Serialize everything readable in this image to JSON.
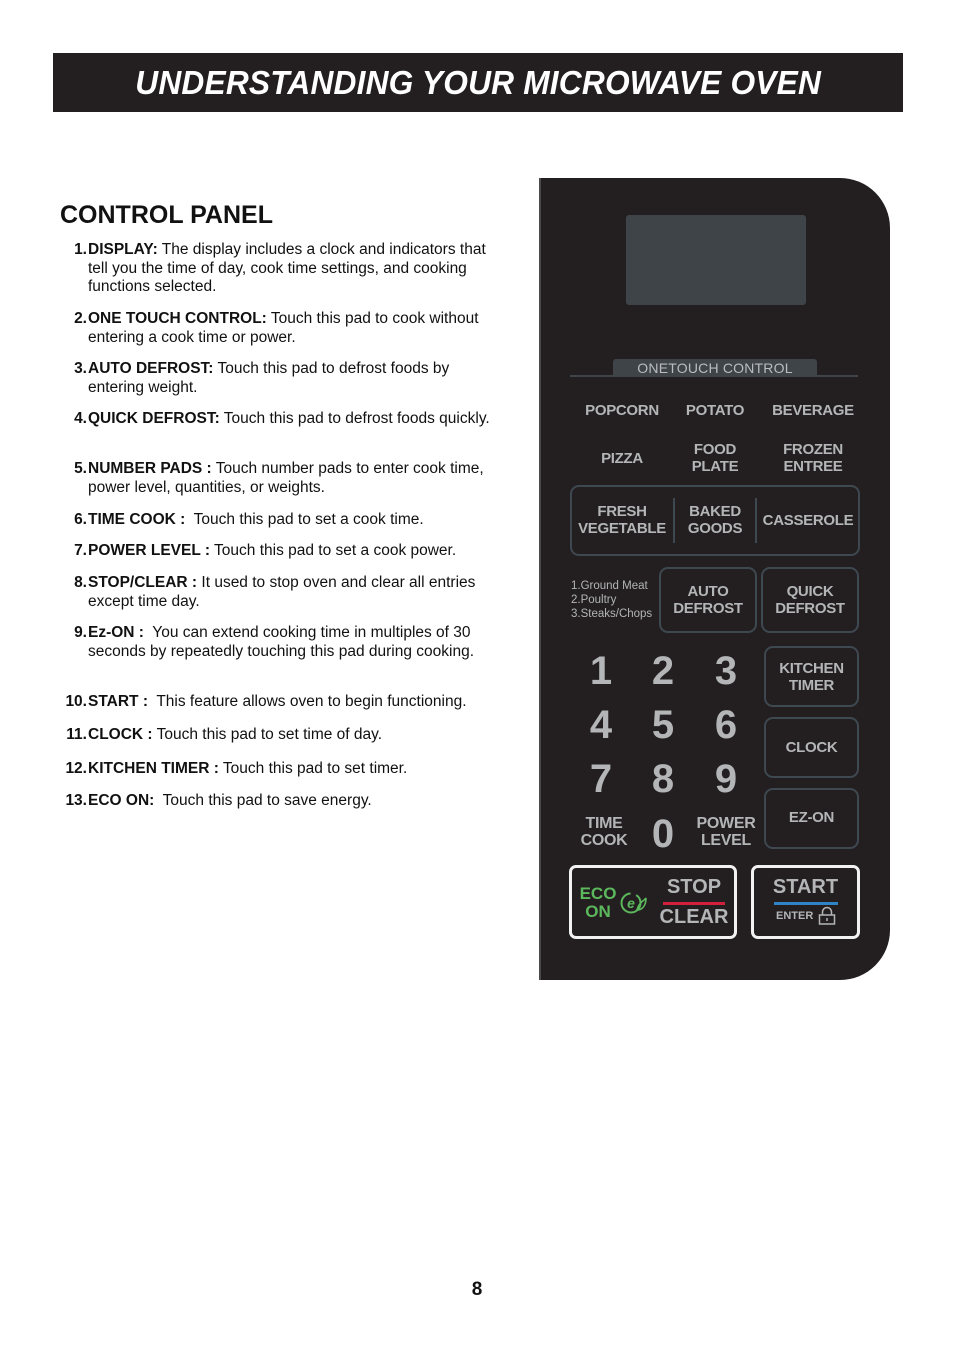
{
  "header": {
    "title": "UNDERSTANDING YOUR MICROWAVE OVEN"
  },
  "section": {
    "title": "CONTROL PANEL"
  },
  "items": [
    {
      "num": "1.",
      "label": "DISPLAY:",
      "text": " The display includes a clock and indicators that tell you the time of day, cook time settings, and cooking functions selected."
    },
    {
      "num": "2.",
      "label": "ONE TOUCH CONTROL:",
      "text": " Touch this pad to cook without entering a cook time or power."
    },
    {
      "num": "3.",
      "label": "AUTO DEFROST:",
      "text": " Touch this pad to defrost foods by entering weight."
    },
    {
      "num": "4.",
      "label": "QUICK DEFROST:",
      "text": " Touch this pad to defrost foods quickly."
    },
    {
      "num": "5.",
      "label": "NUMBER PADS :",
      "text": " Touch number pads to enter cook time, power level, quantities, or weights."
    },
    {
      "num": "6.",
      "label": "TIME COOK :",
      "text": "  Touch this pad to set a cook time."
    },
    {
      "num": "7.",
      "label": "POWER LEVEL :",
      "text": " Touch this pad to set a cook power."
    },
    {
      "num": "8.",
      "label": "STOP/CLEAR :",
      "text": " It used to stop oven and clear all entries except time day."
    },
    {
      "num": "9.",
      "label": "Ez-ON :",
      "text": "  You can extend cooking time in multiples of 30 seconds by repeatedly touching this pad during cooking."
    },
    {
      "num": "10.",
      "label": "START :",
      "text": "  This feature allows oven to begin functioning."
    },
    {
      "num": "11.",
      "label": "CLOCK :",
      "text": " Touch this pad to set time of day."
    },
    {
      "num": "12.",
      "label": "KITCHEN TIMER :",
      "text": " Touch this pad to set timer."
    },
    {
      "num": "13.",
      "label": "ECO ON:",
      "text": "  Touch this pad to save energy."
    }
  ],
  "panel": {
    "one_touch_label": "ONETOUCH CONTROL",
    "one_touch": {
      "popcorn": "POPCORN",
      "potato": "POTATO",
      "beverage": "BEVERAGE",
      "pizza": "PIZZA",
      "food_plate": "FOOD\nPLATE",
      "frozen_entree": "FROZEN\nENTREE",
      "fresh_vegetable": "FRESH\nVEGETABLE",
      "baked_goods": "BAKED\nGOODS",
      "casserole": "CASSEROLE"
    },
    "defrost_options": [
      "1.Ground Meat",
      "2.Poultry",
      "3.Steaks/Chops"
    ],
    "auto_defrost": "AUTO\nDEFROST",
    "quick_defrost": "QUICK\nDEFROST",
    "digits": [
      "1",
      "2",
      "3",
      "4",
      "5",
      "6",
      "7",
      "8",
      "9",
      "0"
    ],
    "time_cook": "TIME\nCOOK",
    "power_level": "POWER\nLEVEL",
    "kitchen_timer": "KITCHEN\nTIMER",
    "clock": "CLOCK",
    "ez_on": "EZ-ON",
    "eco_on": "ECO\nON",
    "eco_glyph": "e",
    "stop": "STOP",
    "clear": "CLEAR",
    "start": "START",
    "enter": "ENTER",
    "colors": {
      "eco": "#5cb85c",
      "stop_bar": "#d11f3c",
      "start_bar": "#2e84c6"
    }
  },
  "footer": {
    "page_number": "8"
  }
}
